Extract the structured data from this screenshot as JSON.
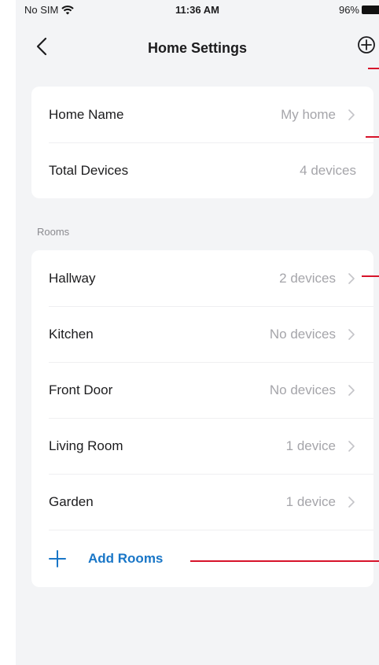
{
  "status_bar": {
    "carrier": "No SIM",
    "time": "11:36 AM",
    "battery": "96%"
  },
  "nav": {
    "title": "Home Settings"
  },
  "home": {
    "name_label": "Home Name",
    "name_value": "My home",
    "devices_label": "Total Devices",
    "devices_value": "4 devices"
  },
  "rooms_section_label": "Rooms",
  "rooms": [
    {
      "name": "Hallway",
      "devices": "2 devices"
    },
    {
      "name": "Kitchen",
      "devices": "No devices"
    },
    {
      "name": "Front Door",
      "devices": "No devices"
    },
    {
      "name": "Living Room",
      "devices": "1 device"
    },
    {
      "name": "Garden",
      "devices": "1 device"
    }
  ],
  "add_rooms_label": "Add Rooms",
  "colors": {
    "accent": "#1976c7",
    "annotation": "#d7132a",
    "background": "#f3f4f6",
    "card": "#ffffff"
  },
  "icons": [
    "wifi-icon",
    "battery-icon",
    "back-chevron-icon",
    "add-circle-icon",
    "chevron-right-icon",
    "plus-icon"
  ]
}
